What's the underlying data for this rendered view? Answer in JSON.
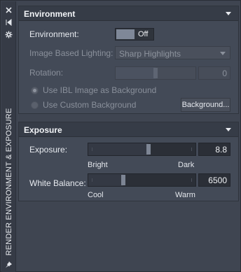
{
  "strip": {
    "title": "RENDER ENVIRONMENT & EXPOSURE",
    "icons": [
      "close-icon",
      "collapse-icon",
      "settings-icon",
      "pin-icon"
    ]
  },
  "environment": {
    "header": "Environment",
    "environment_label": "Environment:",
    "environment_toggle": "Off",
    "ibl_label": "Image Based Lighting:",
    "ibl_value": "Sharp Highlights",
    "rotation_label": "Rotation:",
    "rotation_value": "0",
    "rotation_level": 0.5,
    "use_ibl_bg_label": "Use IBL Image as Background",
    "use_custom_bg_label": "Use Custom Background",
    "background_button": "Background..."
  },
  "exposure": {
    "header": "Exposure",
    "exposure_label": "Exposure:",
    "exposure_value": "8.8",
    "exposure_level": 0.56,
    "bright_label": "Bright",
    "dark_label": "Dark",
    "white_balance_label": "White Balance:",
    "white_balance_value": "6500",
    "white_balance_level": 0.33,
    "cool_label": "Cool",
    "warm_label": "Warm"
  },
  "colors": {
    "background": "#404653",
    "header": "#363c47",
    "field": "#2b2f37",
    "thumb": "#7d8594"
  }
}
